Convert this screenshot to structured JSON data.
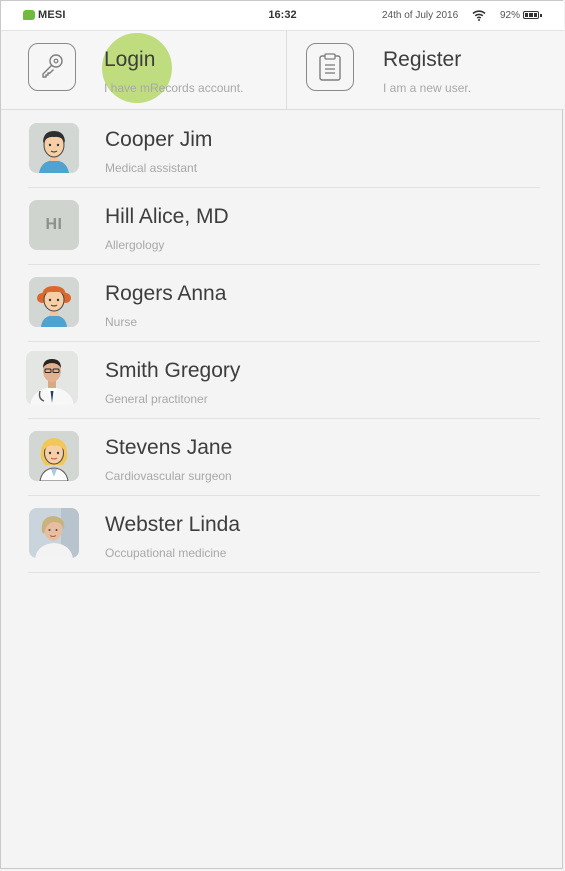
{
  "status_bar": {
    "brand": "MESI",
    "time": "16:32",
    "date": "24th of July 2016",
    "battery": "92%"
  },
  "actions": {
    "login": {
      "title": "Login",
      "subtitle": "I have mRecords account.",
      "icon": "key-icon"
    },
    "register": {
      "title": "Register",
      "subtitle": "I am a new user.",
      "icon": "clipboard-icon"
    }
  },
  "users": [
    {
      "name": "Cooper Jim",
      "role": "Medical assistant",
      "avatar": "cartoon-man"
    },
    {
      "name": "Hill Alice, MD",
      "role": "Allergology",
      "avatar": "initials",
      "initials": "HI"
    },
    {
      "name": "Rogers Anna",
      "role": "Nurse",
      "avatar": "cartoon-redhead"
    },
    {
      "name": "Smith Gregory",
      "role": "General practitoner",
      "avatar": "photo-doctor-man"
    },
    {
      "name": "Stevens Jane",
      "role": "Cardiovascular surgeon",
      "avatar": "cartoon-blonde"
    },
    {
      "name": "Webster Linda",
      "role": "Occupational medicine",
      "avatar": "photo-doctor-woman"
    }
  ],
  "colors": {
    "brand": "#6dbb3f",
    "tap_highlight": "#b0d55e",
    "background": "#f3f4f3"
  }
}
